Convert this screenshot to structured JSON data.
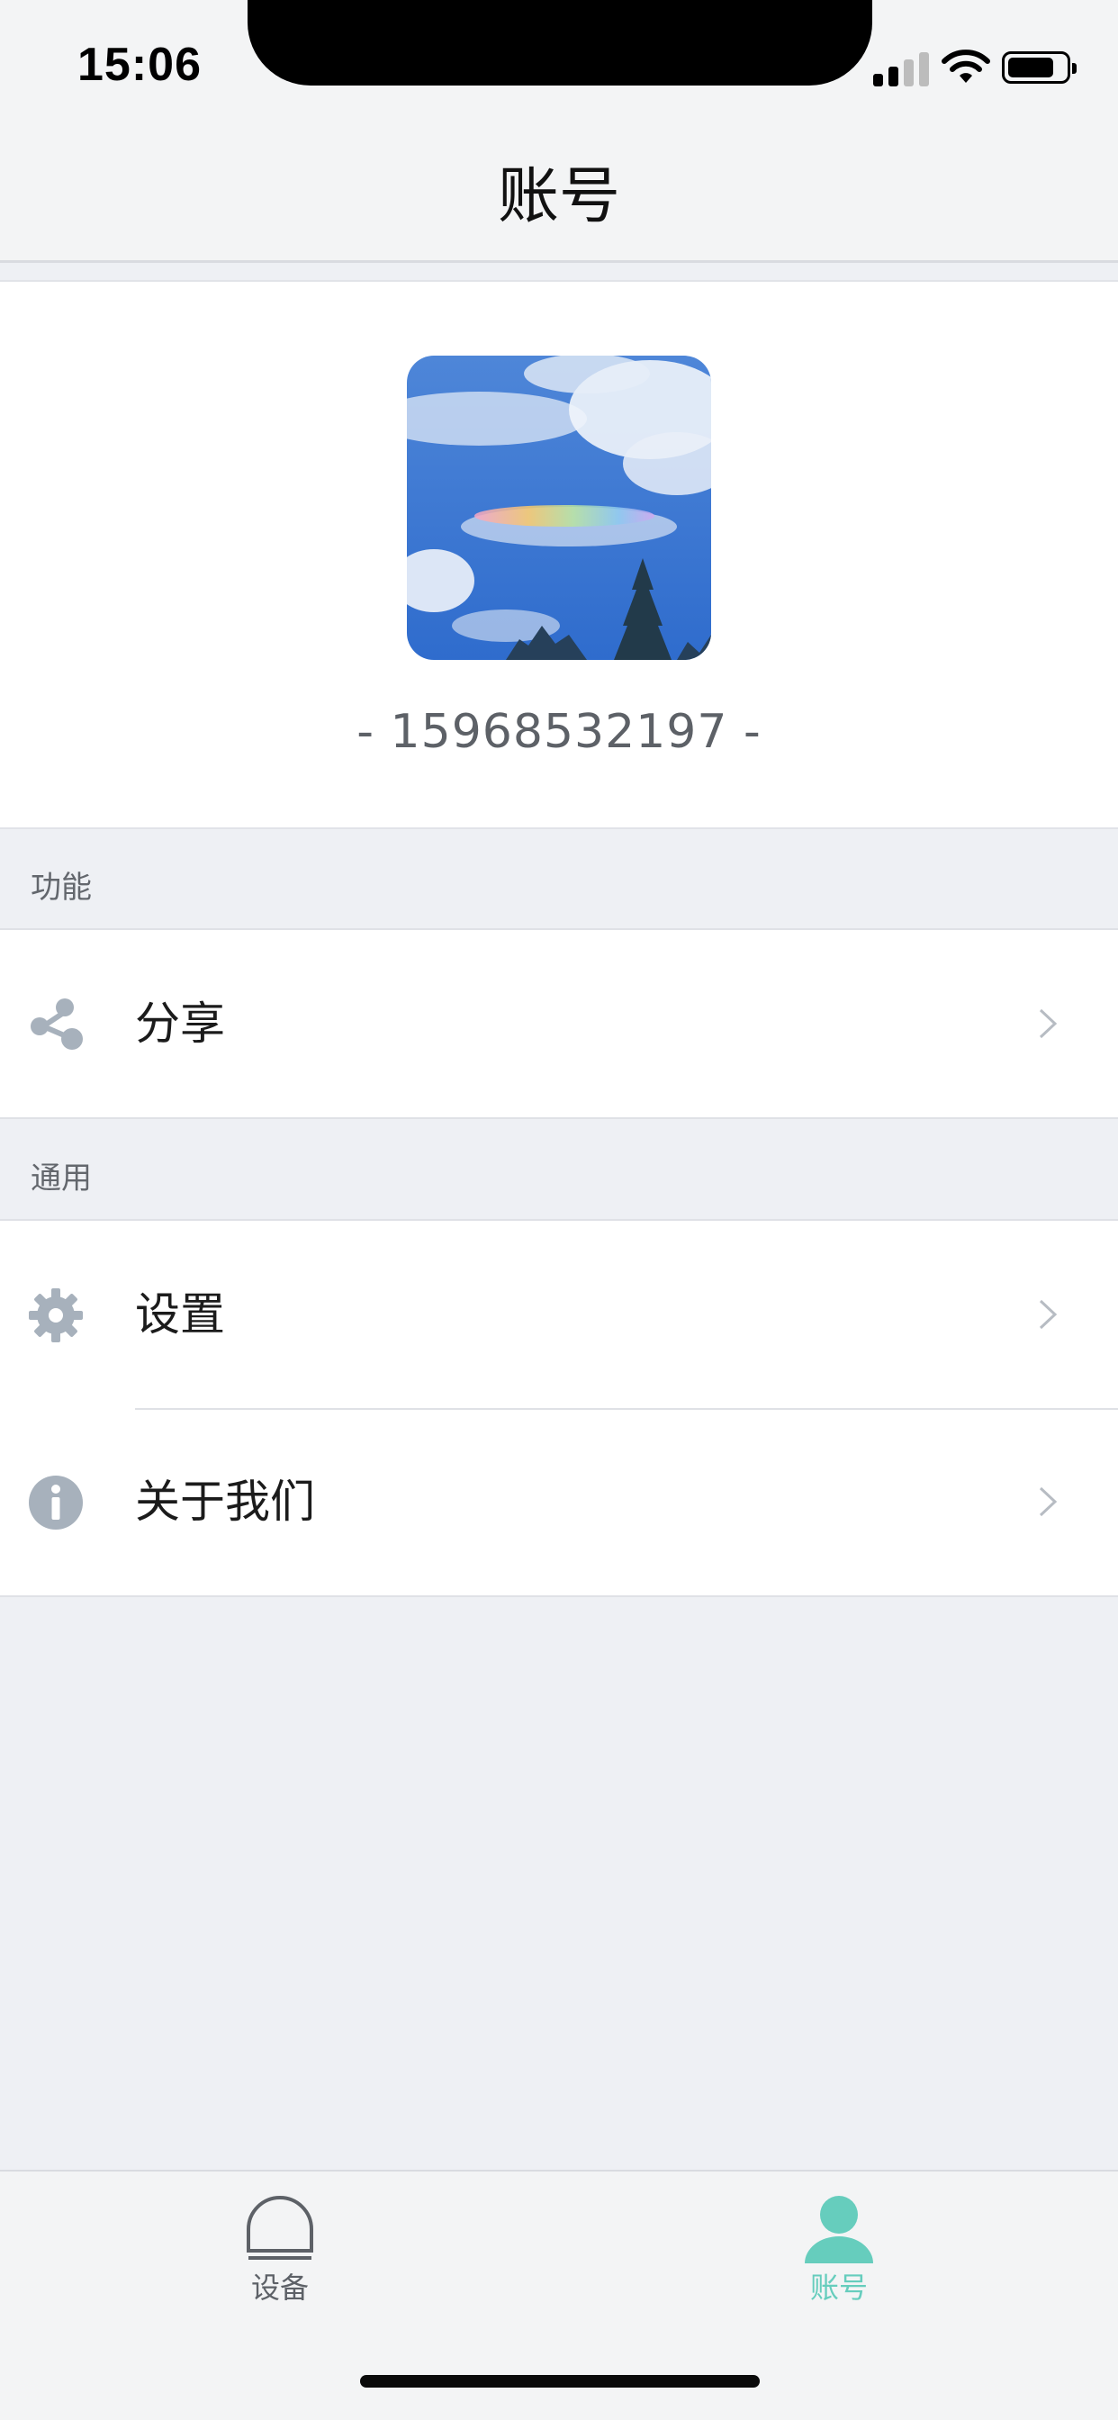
{
  "status_bar": {
    "time": "15:06",
    "icons": [
      "signal-icon",
      "wifi-icon",
      "battery-icon"
    ]
  },
  "header": {
    "title": "账号"
  },
  "profile": {
    "avatar": "sky-with-rainbow-cloud-photo",
    "phone": "- 15968532197 -"
  },
  "sections": [
    {
      "title": "功能",
      "items": [
        {
          "label": "分享",
          "icon": "share-icon"
        }
      ]
    },
    {
      "title": "通用",
      "items": [
        {
          "label": "设置",
          "icon": "gear-icon"
        },
        {
          "label": "关于我们",
          "icon": "info-icon"
        }
      ]
    }
  ],
  "tabbar": {
    "tabs": [
      {
        "label": "设备",
        "icon": "device-icon",
        "active": false
      },
      {
        "label": "账号",
        "icon": "person-icon",
        "active": true
      }
    ]
  },
  "colors": {
    "accent": "#66cdbd",
    "background": "#eef0f4",
    "icon_gray": "#a7b1bc",
    "text_gray": "#5d6167"
  }
}
